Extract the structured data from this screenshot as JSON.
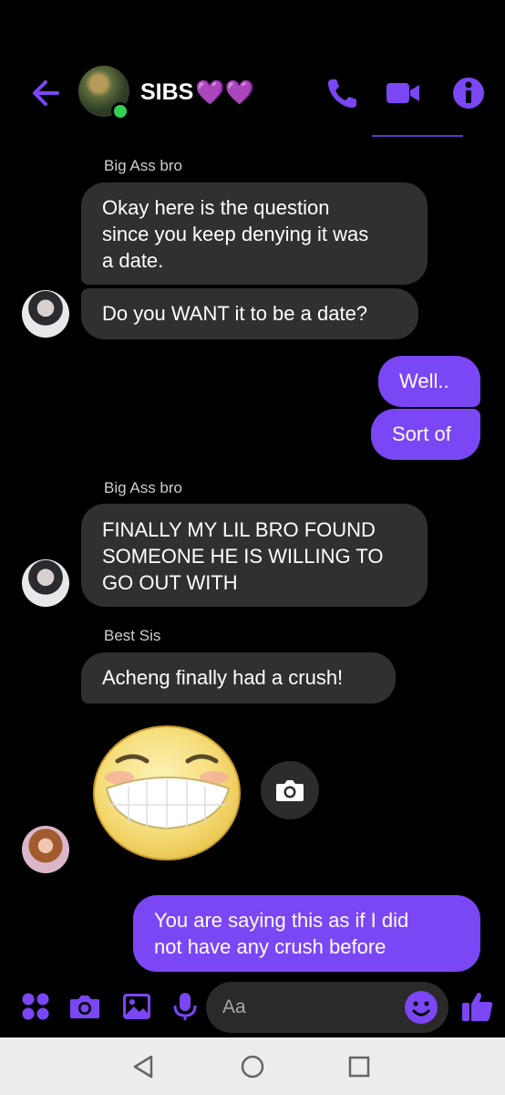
{
  "header": {
    "title": "SIBS",
    "title_hearts": "💜💜"
  },
  "messages": {
    "sender1": "Big Ass bro",
    "m1": [
      "Okay here is the question",
      "since you keep denying it was",
      "a date."
    ],
    "m2": "Do you WANT it to be a date?",
    "me1": "Well..",
    "me2": "Sort of",
    "sender2": "Big Ass bro",
    "m3": [
      "FINALLY MY LIL BRO FOUND",
      "SOMEONE HE IS WILLING TO",
      "GO OUT WITH"
    ],
    "sender3": "Best Sis",
    "m4": "Acheng finally had a crush!",
    "me3": [
      "You are saying this as if I did",
      "not have any crush before"
    ]
  },
  "composer": {
    "placeholder": "Aa"
  },
  "colors": {
    "accent": "#7b46f4",
    "bubble_other": "#303030",
    "online": "#31d158"
  },
  "icons": [
    "back-arrow-icon",
    "phone-icon",
    "video-camera-icon",
    "info-icon",
    "apps-icon",
    "camera-icon",
    "gallery-icon",
    "microphone-icon",
    "emoji-icon",
    "thumbs-up-icon"
  ]
}
